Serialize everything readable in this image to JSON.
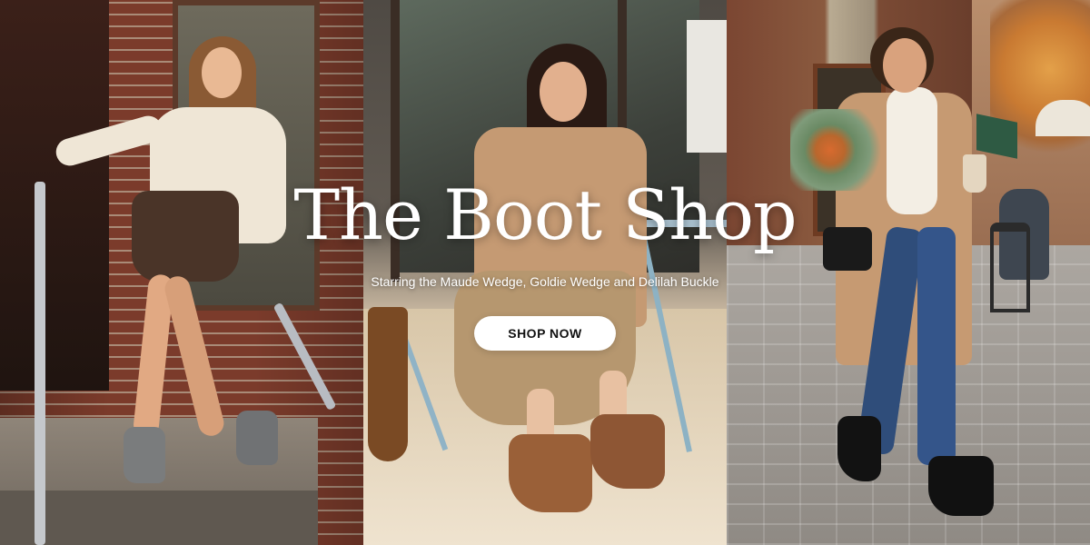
{
  "hero": {
    "title": "The Boot Shop",
    "subtitle": "Starring the Maude Wedge, Goldie Wedge and Delilah Buckle",
    "cta_label": "SHOP NOW"
  }
}
